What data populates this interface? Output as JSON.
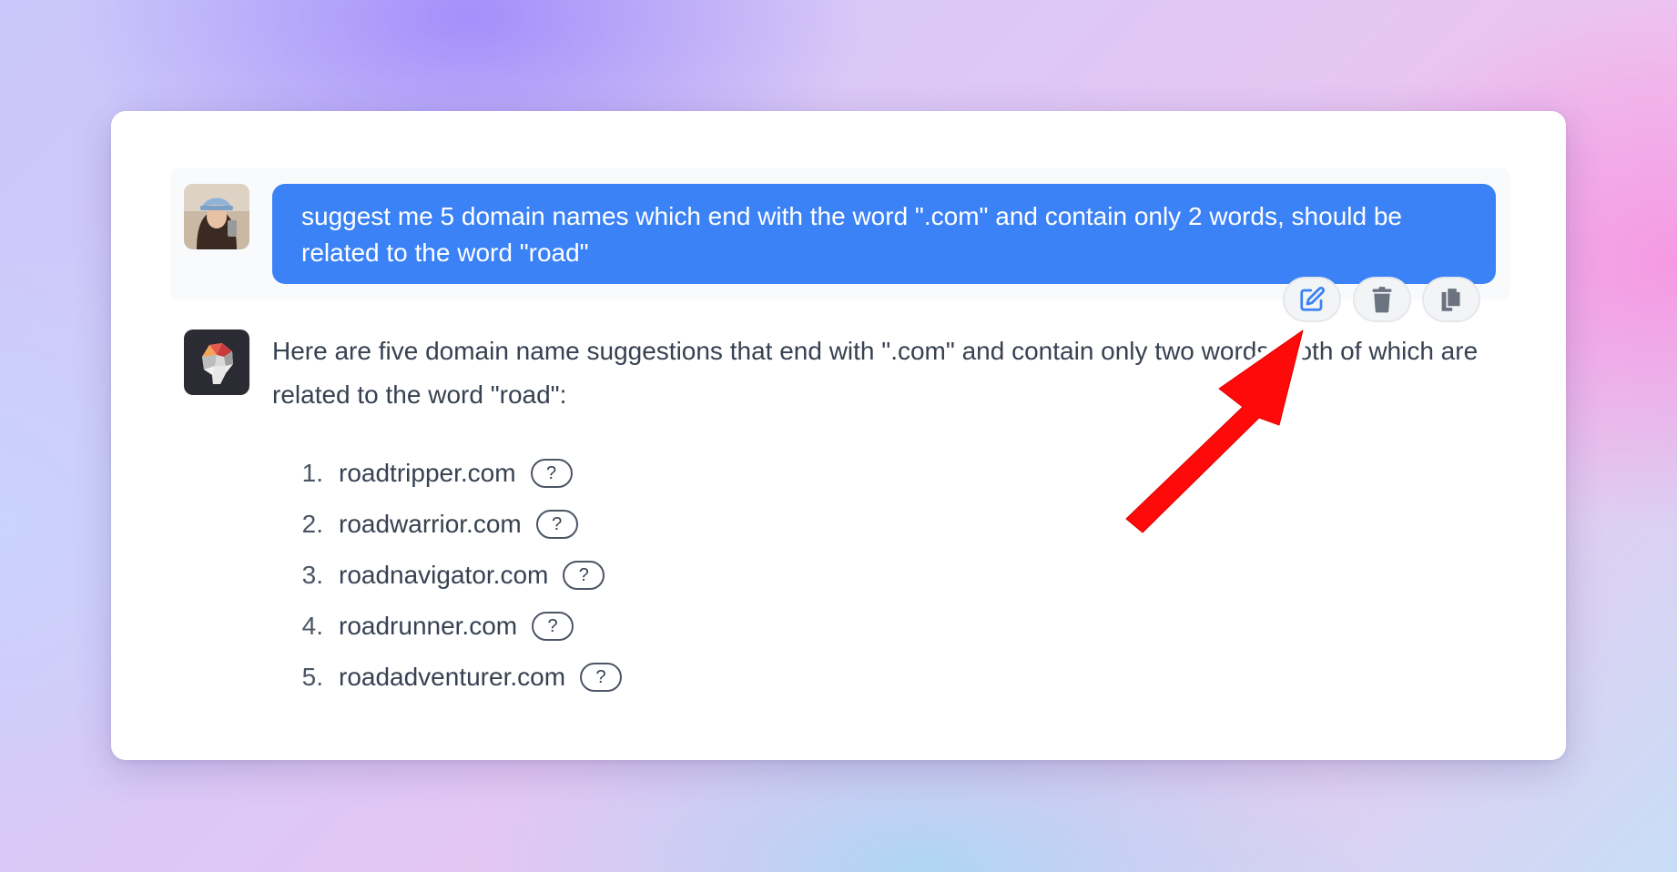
{
  "conversation": {
    "user_message": {
      "text": "suggest me 5 domain names which end with the word \".com\" and contain only 2 words, should be related to the word \"road\""
    },
    "message_actions": [
      {
        "name": "edit",
        "icon": "pencil-square-icon"
      },
      {
        "name": "delete",
        "icon": "trash-icon"
      },
      {
        "name": "copy",
        "icon": "copy-icon"
      }
    ],
    "assistant_message": {
      "intro": "Here are five domain name suggestions that end with \".com\" and contain only two words, both of which are related to the word \"road\":",
      "list": [
        {
          "num": "1.",
          "domain": "roadtripper.com",
          "help": "?"
        },
        {
          "num": "2.",
          "domain": "roadwarrior.com",
          "help": "?"
        },
        {
          "num": "3.",
          "domain": "roadnavigator.com",
          "help": "?"
        },
        {
          "num": "4.",
          "domain": "roadrunner.com",
          "help": "?"
        },
        {
          "num": "5.",
          "domain": "roadadventurer.com",
          "help": "?"
        }
      ]
    }
  },
  "annotation": {
    "type": "arrow",
    "color": "#ff0000",
    "points_to": "edit"
  },
  "colors": {
    "user_bubble": "#3b82f6",
    "text": "#374151",
    "action_icon_edit": "#3b82f6",
    "action_icon_default": "#6b7280"
  }
}
